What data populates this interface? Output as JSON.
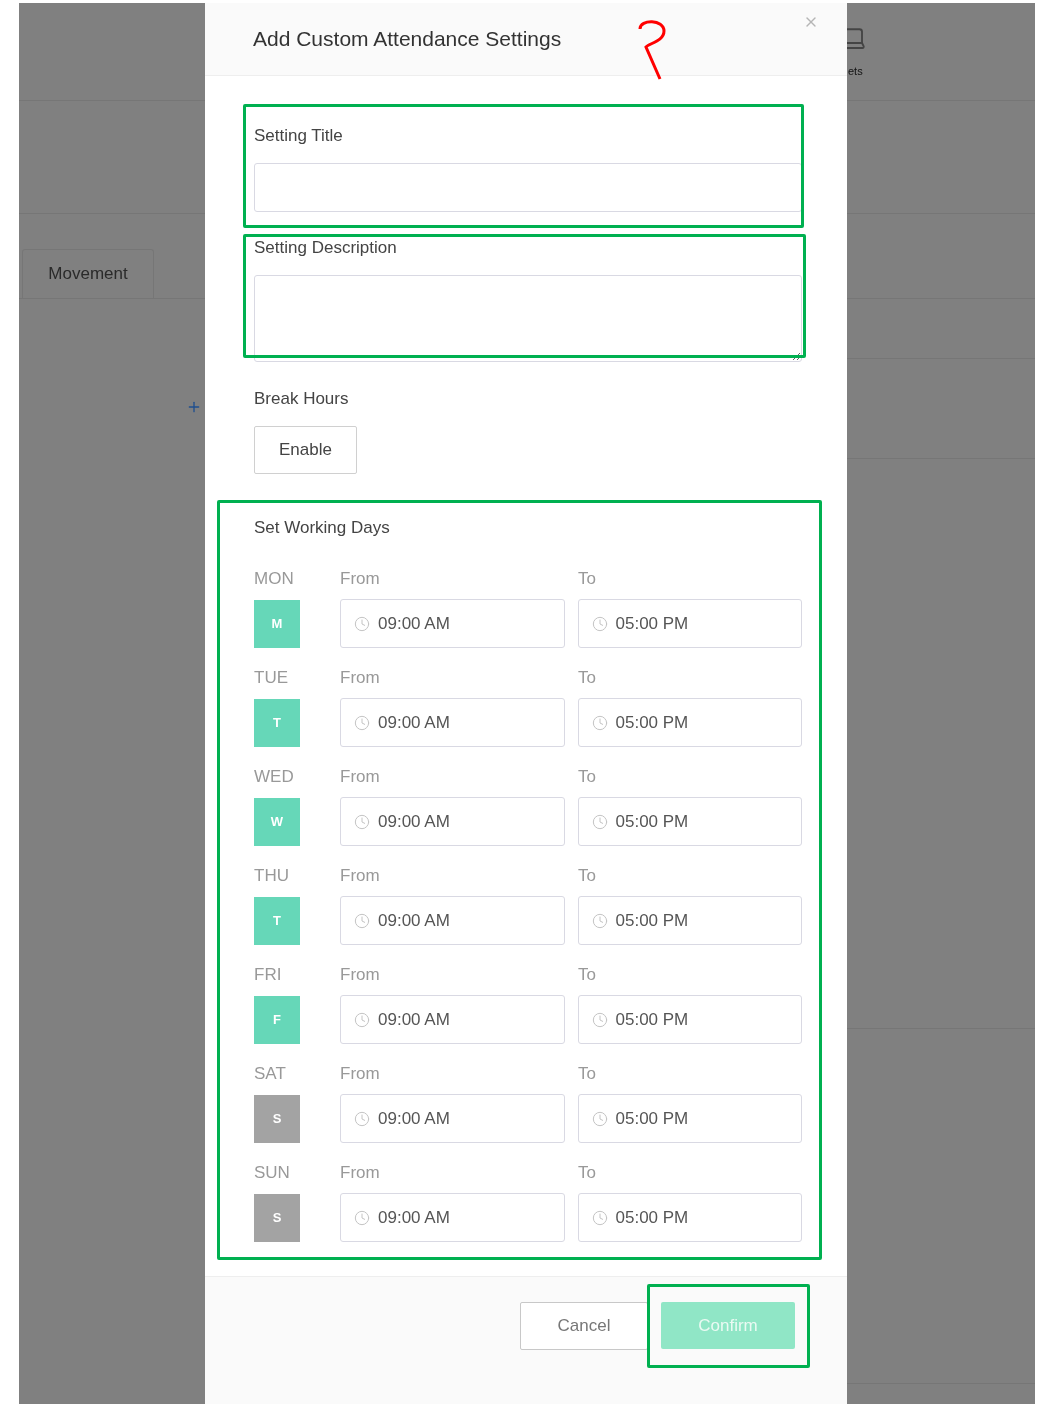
{
  "background": {
    "tab": "Movement",
    "partial_label": "ets"
  },
  "dialog": {
    "title": "Add Custom Attendance Settings",
    "fields": [
      {
        "label": "Setting Title",
        "kind": "input"
      },
      {
        "label": "Setting Description",
        "kind": "textarea"
      }
    ],
    "break_hours": {
      "label": "Break Hours",
      "button": "Enable"
    },
    "working_days": {
      "title": "Set Working Days",
      "days": [
        {
          "name": "MON",
          "letter": "M",
          "selected": true,
          "from_label": "From",
          "from": "09:00 AM",
          "to_label": "To",
          "to": "05:00 PM"
        },
        {
          "name": "TUE",
          "letter": "T",
          "selected": true,
          "from_label": "From",
          "from": "09:00 AM",
          "to_label": "To",
          "to": "05:00 PM"
        },
        {
          "name": "WED",
          "letter": "W",
          "selected": true,
          "from_label": "From",
          "from": "09:00 AM",
          "to_label": "To",
          "to": "05:00 PM"
        },
        {
          "name": "THU",
          "letter": "T",
          "selected": true,
          "from_label": "From",
          "from": "09:00 AM",
          "to_label": "To",
          "to": "05:00 PM"
        },
        {
          "name": "FRI",
          "letter": "F",
          "selected": true,
          "from_label": "From",
          "from": "09:00 AM",
          "to_label": "To",
          "to": "05:00 PM"
        },
        {
          "name": "SAT",
          "letter": "S",
          "selected": false,
          "from_label": "From",
          "from": "09:00 AM",
          "to_label": "To",
          "to": "05:00 PM"
        },
        {
          "name": "SUN",
          "letter": "S",
          "selected": false,
          "from_label": "From",
          "from": "09:00 AM",
          "to_label": "To",
          "to": "05:00 PM"
        }
      ]
    },
    "footer": {
      "cancel": "Cancel",
      "confirm": "Confirm",
      "confirm_disabled": true
    }
  }
}
